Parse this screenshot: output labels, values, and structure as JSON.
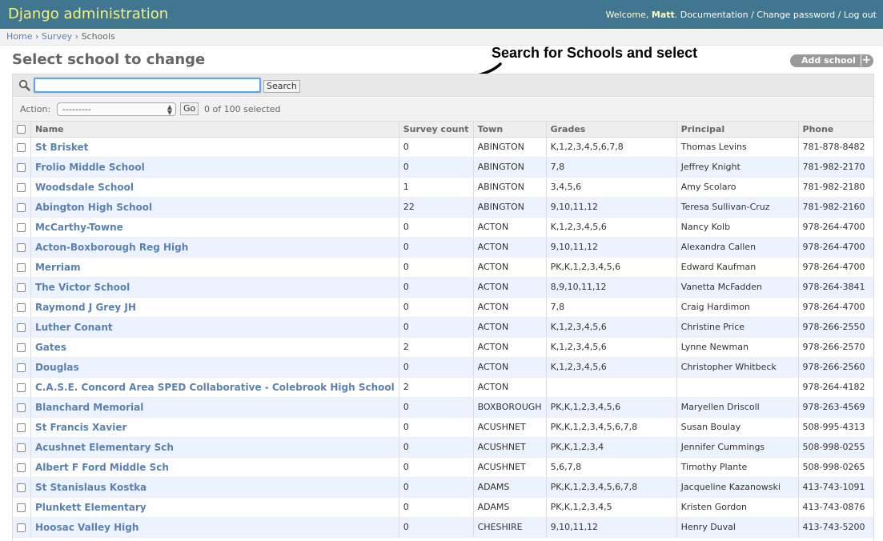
{
  "header": {
    "brand": "Django administration",
    "welcome": "Welcome, ",
    "user": "Matt",
    "welcome_end": ". ",
    "documentation": "Documentation",
    "change_password": "Change password",
    "logout": "Log out",
    "separator": " / "
  },
  "breadcrumbs": {
    "home": "Home",
    "app": "Survey",
    "current": "Schools",
    "separator": " › "
  },
  "page_title": "Select school to change",
  "annotation": "Search for Schools and select",
  "add_button": {
    "label": "Add school",
    "icon": "plus-icon"
  },
  "search": {
    "value": "",
    "button": "Search",
    "icon": "magnifier-icon"
  },
  "actions": {
    "label": "Action:",
    "selected": "---------",
    "go": "Go",
    "counter": "0 of 100 selected"
  },
  "table": {
    "columns": [
      "Name",
      "Survey count",
      "Town",
      "Grades",
      "Principal",
      "Phone"
    ],
    "rows": [
      [
        "St Brisket",
        "0",
        "ABINGTON",
        "K,1,2,3,4,5,6,7,8",
        "Thomas Levins",
        "781-878-8482"
      ],
      [
        "Frolio Middle School",
        "0",
        "ABINGTON",
        "7,8",
        "Jeffrey Knight",
        "781-982-2170"
      ],
      [
        "Woodsdale School",
        "1",
        "ABINGTON",
        "3,4,5,6",
        "Amy Scolaro",
        "781-982-2180"
      ],
      [
        "Abington High School",
        "22",
        "ABINGTON",
        "9,10,11,12",
        "Teresa Sullivan-Cruz",
        "781-982-2160"
      ],
      [
        "McCarthy-Towne",
        "0",
        "ACTON",
        "K,1,2,3,4,5,6",
        "Nancy Kolb",
        "978-264-4700"
      ],
      [
        "Acton-Boxborough Reg High",
        "0",
        "ACTON",
        "9,10,11,12",
        "Alexandra Callen",
        "978-264-4700"
      ],
      [
        "Merriam",
        "0",
        "ACTON",
        "PK,K,1,2,3,4,5,6",
        "Edward Kaufman",
        "978-264-4700"
      ],
      [
        "The Victor School",
        "0",
        "ACTON",
        "8,9,10,11,12",
        "Vanetta McFadden",
        "978-264-3841"
      ],
      [
        "Raymond J Grey JH",
        "0",
        "ACTON",
        "7,8",
        "Craig Hardimon",
        "978-264-4700"
      ],
      [
        "Luther Conant",
        "0",
        "ACTON",
        "K,1,2,3,4,5,6",
        "Christine Price",
        "978-266-2550"
      ],
      [
        "Gates",
        "2",
        "ACTON",
        "K,1,2,3,4,5,6",
        "Lynne Newman",
        "978-266-2570"
      ],
      [
        "Douglas",
        "0",
        "ACTON",
        "K,1,2,3,4,5,6",
        "Christopher Whitbeck",
        "978-266-2560"
      ],
      [
        "C.A.S.E. Concord Area SPED Collaborative - Colebrook High School",
        "2",
        "ACTON",
        "",
        "",
        "978-264-4182"
      ],
      [
        "Blanchard Memorial",
        "0",
        "BOXBOROUGH",
        "PK,K,1,2,3,4,5,6",
        "Maryellen Driscoll",
        "978-263-4569"
      ],
      [
        "St Francis Xavier",
        "0",
        "ACUSHNET",
        "PK,K,1,2,3,4,5,6,7,8",
        "Susan Boulay",
        "508-995-4313"
      ],
      [
        "Acushnet Elementary Sch",
        "0",
        "ACUSHNET",
        "PK,K,1,2,3,4",
        "Jennifer Cummings",
        "508-998-0255"
      ],
      [
        "Albert F Ford Middle Sch",
        "0",
        "ACUSHNET",
        "5,6,7,8",
        "Timothy Plante",
        "508-998-0265"
      ],
      [
        "St Stanislaus Kostka",
        "0",
        "ADAMS",
        "PK,K,1,2,3,4,5,6,7,8",
        "Jacqueline Kazanowski",
        "413-743-1091"
      ],
      [
        "Plunkett Elementary",
        "0",
        "ADAMS",
        "PK,K,1,2,3,4,5",
        "Kristen Gordon",
        "413-743-0876"
      ],
      [
        "Hoosac Valley High",
        "0",
        "CHESHIRE",
        "9,10,11,12",
        "Henry Duval",
        "413-743-5200"
      ]
    ]
  },
  "colors": {
    "header_bg": "#417690",
    "brand": "#f4f379",
    "link": "#5b80b2",
    "row_alt": "#edf3fe"
  }
}
